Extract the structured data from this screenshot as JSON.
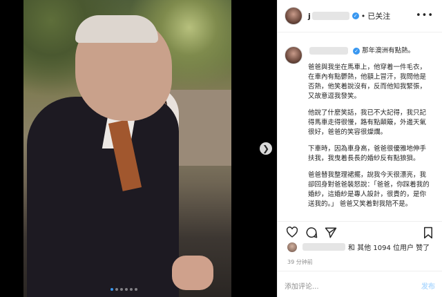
{
  "post": {
    "header": {
      "username_prefix": "j",
      "verified_mark": "✓",
      "separator": "•",
      "follow_status": "已关注",
      "more_label": "•••"
    },
    "caption": {
      "author_prefix": "",
      "title": "那年澳洲有點熱。",
      "paragraphs": [
        "爸爸與我坐在馬車上，他穿着一件毛衣，在車內有點鬱熱，他額上冒汗，我問他是否熱，他笑着說沒有，反而他知我緊張，又故意逗我發笑。",
        "他說了什麼笑話，我已不大記得，我只記得馬車走得很慢，路有點顛簸，外邊天氣很好，爸爸的笑容很燦爛。",
        "下車時，因為車身高，爸爸很優雅地伸手扶我，我曳着長長的婚紗反有點狼狽。",
        "爸爸替我整理裙擺，說我今天很漂亮，我卻回身對爸爸裝怒說：「爸爸，你踩着我的婚紗，這婚紗是專人設計，很貴的，是你送我的。」 爸爸又笑着對我陪不是。"
      ]
    },
    "likes": {
      "text": "和 其他 1094 位用户 赞了"
    },
    "time_ago": "39 分钟前",
    "comment": {
      "placeholder": "添加评论...",
      "post_label": "发布"
    },
    "carousel": {
      "dots": 6,
      "active_index": 0,
      "next_icon": "chevron-right-icon",
      "next_glyph": "❯"
    },
    "icons": {
      "like": "heart-icon",
      "comment": "comment-icon",
      "share": "share-icon",
      "save": "bookmark-icon"
    },
    "colors": {
      "accent": "#3897f0",
      "text": "#262626",
      "muted": "#8e8e8e",
      "border": "#efefef"
    }
  }
}
